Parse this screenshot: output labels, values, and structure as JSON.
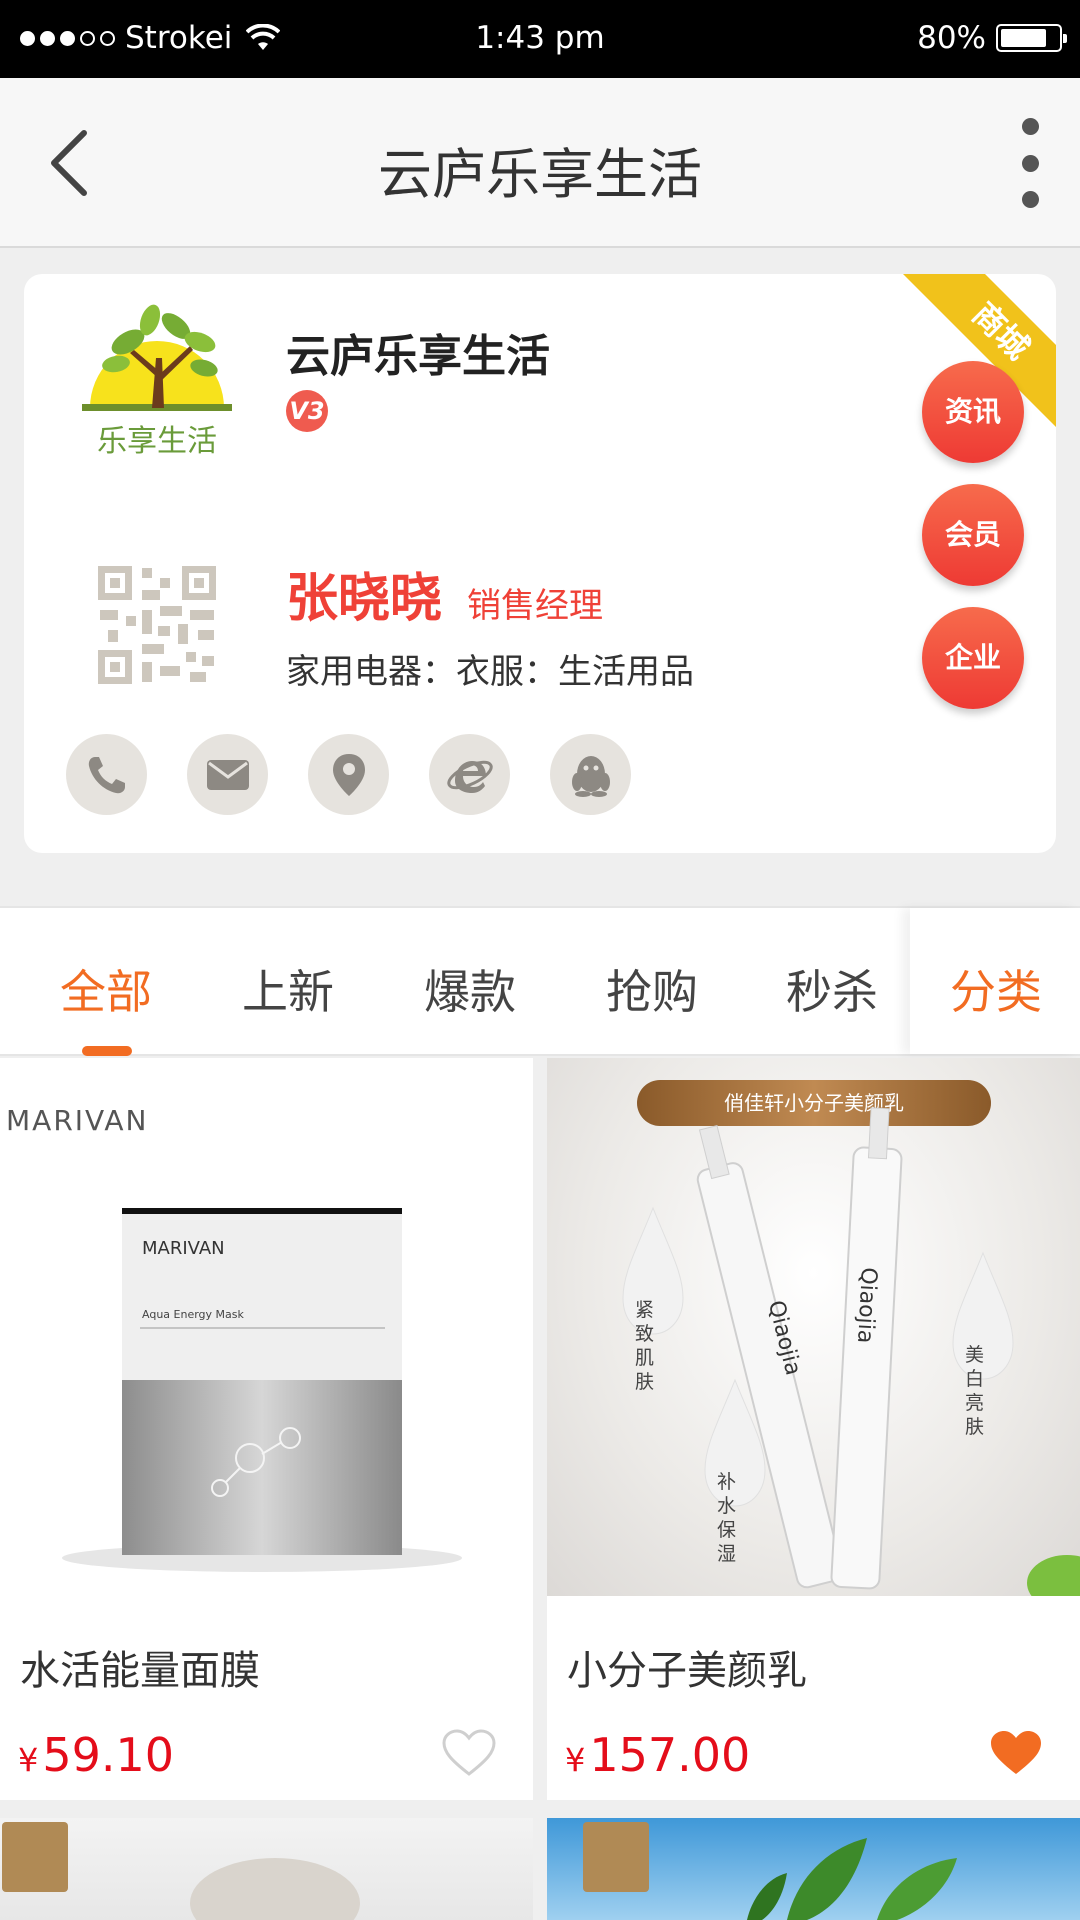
{
  "status_bar": {
    "carrier": "Strokei",
    "time": "1:43 pm",
    "battery": "80%",
    "battery_level": 0.8
  },
  "nav": {
    "title": "云庐乐享生活"
  },
  "shop": {
    "ribbon": "商城",
    "logo_text": "乐享生活",
    "name": "云庐乐享生活",
    "level_badge": "V3",
    "person_name": "张晓晓",
    "person_title": "销售经理",
    "tags": "家用电器：衣服：生活用品",
    "side_buttons": [
      "资讯",
      "会员",
      "企业"
    ]
  },
  "tabs": {
    "items": [
      "全部",
      "上新",
      "爆款",
      "抢购",
      "秒杀"
    ],
    "active_index": 0,
    "category": "分类"
  },
  "products": [
    {
      "brand_text": "MARIVAN",
      "pack_brand": "MARIVAN",
      "pack_line": "Aqua Energy Mask",
      "name": "水活能量面膜",
      "currency": "¥",
      "price": "59.10",
      "favorited": false
    },
    {
      "banner": "俏佳轩小分子美颜乳",
      "drops": [
        "紧致肌肤",
        "补水保湿",
        "美白亮肤"
      ],
      "tube_brand": "Qiaojia",
      "name": "小分子美颜乳",
      "currency": "¥",
      "price": "157.00",
      "favorited": true
    }
  ],
  "colors": {
    "accent": "#f26c22",
    "price": "#e40d1a",
    "ribbon": "#f1c21b",
    "side_button": "#ee3a34"
  }
}
